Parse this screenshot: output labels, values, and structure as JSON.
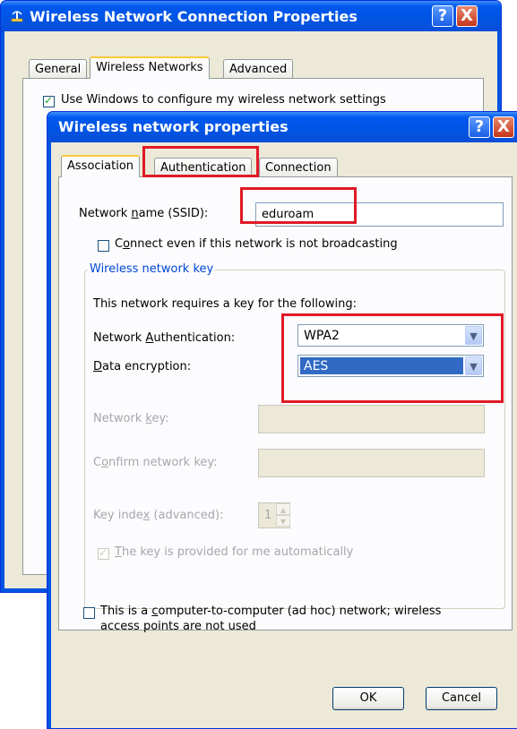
{
  "back_window": {
    "title": "Wireless Network Connection Properties",
    "tabs": [
      "General",
      "Wireless Networks",
      "Advanced"
    ],
    "partial_text": "Use Windows to configure my wireless network settings",
    "help_glyph": "?",
    "close_glyph": "X"
  },
  "front_window": {
    "title": "Wireless network properties",
    "help_glyph": "?",
    "close_glyph": "X",
    "tabs": [
      "Association",
      "Authentication",
      "Connection"
    ],
    "ssid_label_pre": "Network ",
    "ssid_label_u": "n",
    "ssid_label_post": "ame (SSID):",
    "ssid_value": "eduroam",
    "broadcast_pre": "C",
    "broadcast_u": "o",
    "broadcast_post": "nnect even if this network is not broadcasting",
    "group_title": "Wireless network key",
    "requires_text": "This network requires a key for the following:",
    "auth_label_pre": "Network ",
    "auth_label_u": "A",
    "auth_label_post": "uthentication:",
    "auth_value": "WPA2",
    "enc_label_u": "D",
    "enc_label_post": "ata encryption:",
    "enc_value": "AES",
    "netkey_label_pre": "Network ",
    "netkey_label_u": "k",
    "netkey_label_post": "ey:",
    "confirm_label_pre": "C",
    "confirm_label_u": "o",
    "confirm_label_post": "nfirm network key:",
    "keyindex_label_pre": "Key inde",
    "keyindex_label_u": "x",
    "keyindex_label_post": " (advanced):",
    "keyindex_value": "1",
    "auto_key_u": "T",
    "auto_key_post": "he key is provided for me automatically",
    "adhoc_pre": "This is a ",
    "adhoc_u": "c",
    "adhoc_post": "omputer-to-computer (ad hoc) network; wireless",
    "adhoc_line2": "access points are not used",
    "ok_label": "OK",
    "cancel_label": "Cancel"
  },
  "icons": {
    "dropdown": "▼",
    "spin_up": "▲",
    "spin_down": "▼",
    "network": "network-icon"
  },
  "colors": {
    "titlebar": "#0054e3",
    "dialog_face": "#ece9d8",
    "highlight": "#e01a26",
    "selection": "#316ac5"
  }
}
